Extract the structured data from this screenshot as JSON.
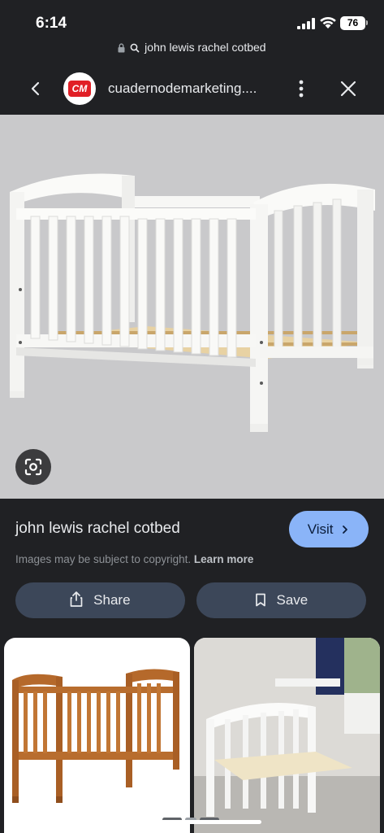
{
  "status_bar": {
    "time": "6:14",
    "battery": "76",
    "icons": [
      "signal-bars-icon",
      "wifi-icon",
      "battery-icon"
    ]
  },
  "url_bar": {
    "text": "john lewis rachel cotbed",
    "icons": [
      "lock-icon",
      "search-icon"
    ]
  },
  "header": {
    "logo_text": "CM",
    "site_name": "cuadernodemarketing....",
    "icons": [
      "back-arrow-icon",
      "more-vert-icon",
      "close-icon"
    ]
  },
  "result": {
    "title": "john lewis rachel cotbed",
    "visit_label": "Visit",
    "copyright_text": "Images may be subject to copyright.",
    "learn_more": "Learn more",
    "share_label": "Share",
    "save_label": "Save"
  },
  "colors": {
    "background": "#202124",
    "image_bg": "#c9c9cb",
    "visit_button": "#8ab4f8",
    "action_button": "#3c4759",
    "logo_red": "#e11f26"
  }
}
